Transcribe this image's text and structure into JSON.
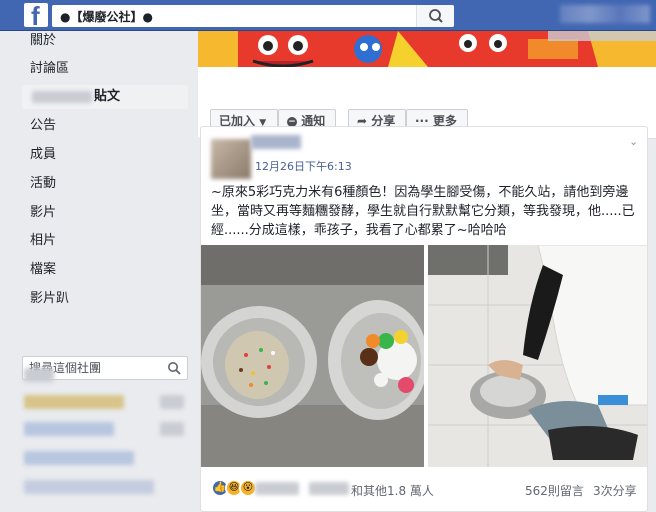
{
  "topbar": {
    "logo": "f",
    "search_value": "●【爆廢公社】●",
    "search_icon": "search-icon",
    "brand_color": "#4267b2"
  },
  "sidebar": {
    "items": [
      {
        "label": "關於",
        "active": false
      },
      {
        "label": "討論區",
        "active": false
      },
      {
        "label": "貼文",
        "active": true
      },
      {
        "label": "公告",
        "active": false
      },
      {
        "label": "成員",
        "active": false
      },
      {
        "label": "活動",
        "active": false
      },
      {
        "label": "影片",
        "active": false
      },
      {
        "label": "相片",
        "active": false
      },
      {
        "label": "檔案",
        "active": false
      },
      {
        "label": "影片趴",
        "active": false
      }
    ],
    "group_search_placeholder": "搜尋這個社團"
  },
  "actions": {
    "joined": "已加入",
    "notify": "通知",
    "share": "分享",
    "more": "更多"
  },
  "post": {
    "timestamp": "12月26日下午6:13",
    "text": "~原來5彩巧克力米有6種顏色！因為學生腳受傷，不能久站，請他到旁邊坐，當時又再等麵糰發酵，學生就自行默默幫它分類，等我發現，他.....已經......分成這樣，乖孩子，我看了心都累了~哈哈哈",
    "reactions": [
      "like",
      "haha",
      "wow"
    ],
    "reaction_summary": "和其他1.8 萬人",
    "comments": "562則留言",
    "shares": "3次分享"
  }
}
